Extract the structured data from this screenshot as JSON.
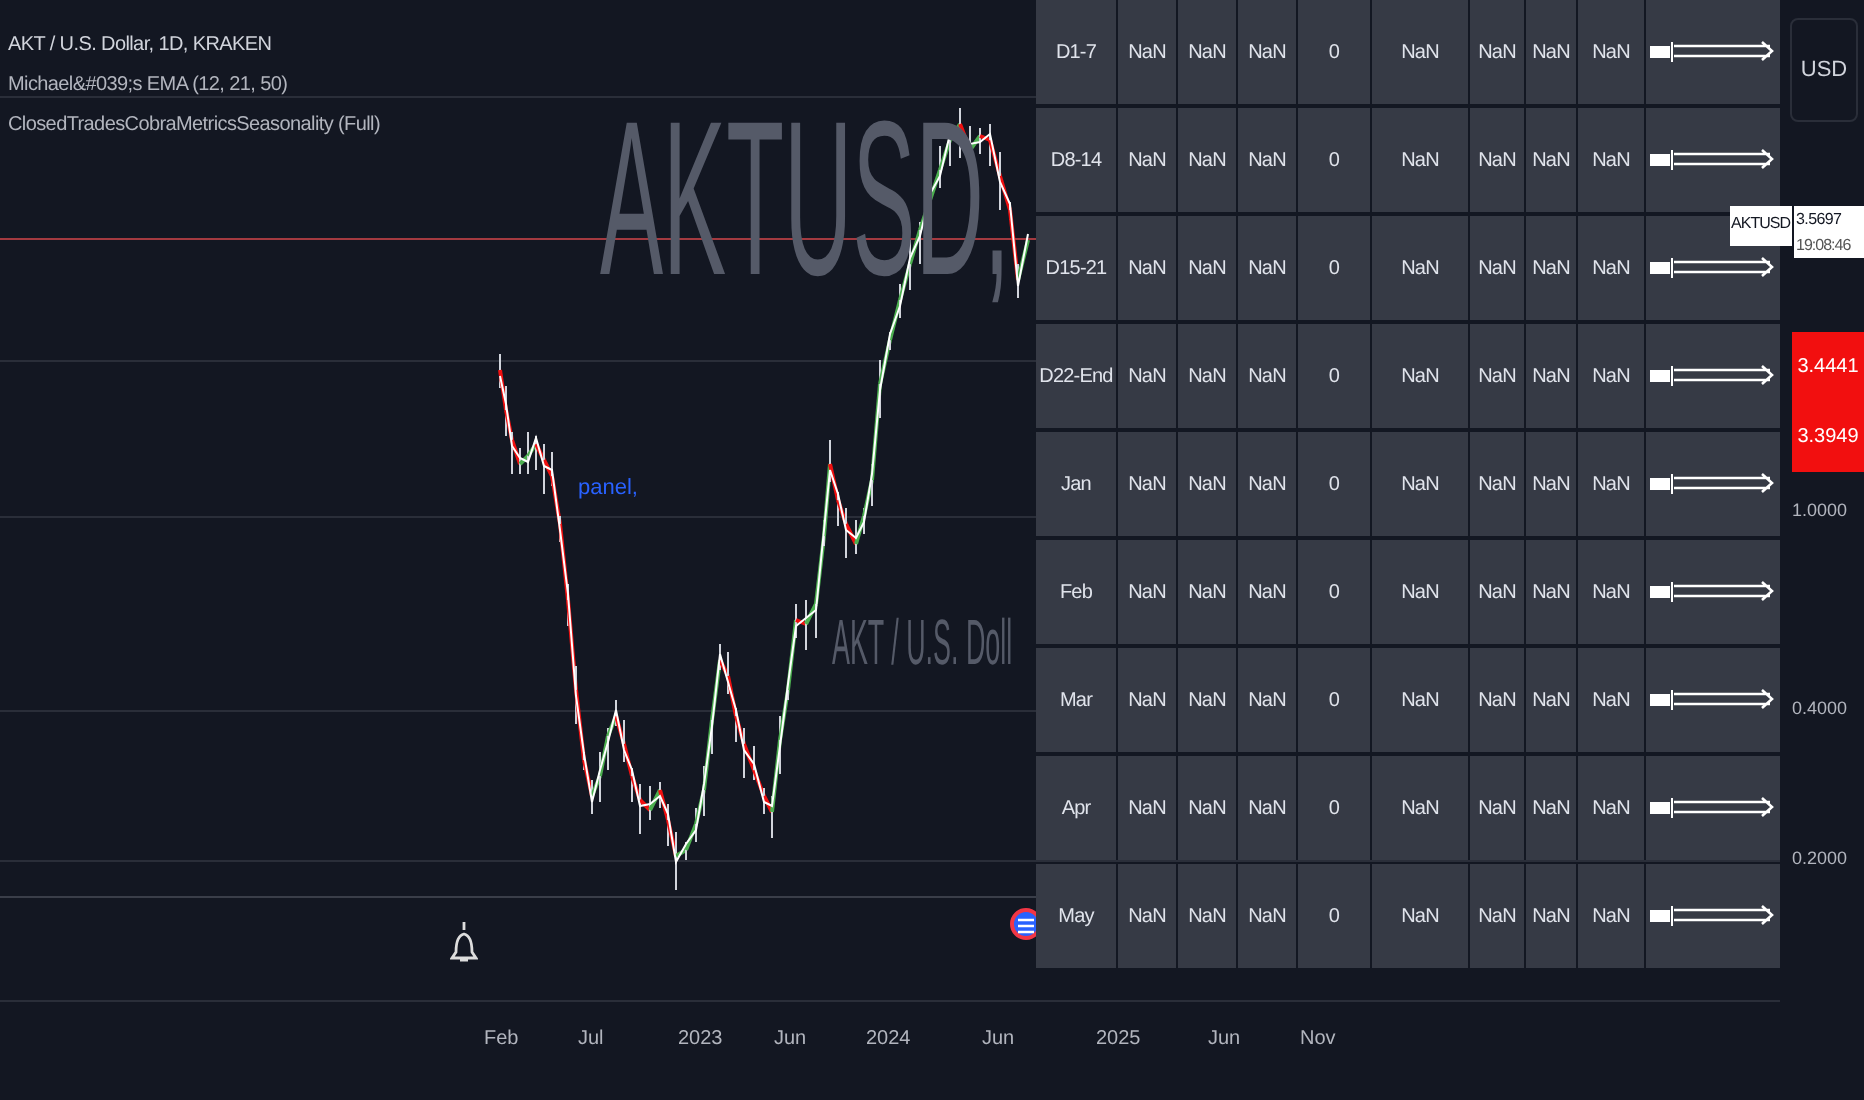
{
  "legend": [
    "AKT / U.S. Dollar, 1D, KRAKEN",
    "Michael&#039;s EMA (12, 21, 50)",
    "ClosedTradesCobraMetricsSeasonality (Full)"
  ],
  "watermark": {
    "symbol": "AKTUSD,",
    "description": "AKT / U.S. Doll"
  },
  "chart_label": "panel,",
  "table": {
    "rows": [
      {
        "label": "D1-7",
        "cells": [
          "NaN",
          "NaN",
          "NaN",
          "0",
          "NaN",
          "NaN",
          "NaN",
          "NaN"
        ]
      },
      {
        "label": "D8-14",
        "cells": [
          "NaN",
          "NaN",
          "NaN",
          "0",
          "NaN",
          "NaN",
          "NaN",
          "NaN"
        ]
      },
      {
        "label": "D15-21",
        "cells": [
          "NaN",
          "NaN",
          "NaN",
          "0",
          "NaN",
          "NaN",
          "NaN",
          "NaN"
        ]
      },
      {
        "label": "D22-End",
        "cells": [
          "NaN",
          "NaN",
          "NaN",
          "0",
          "NaN",
          "NaN",
          "NaN",
          "NaN"
        ]
      },
      {
        "label": "Jan",
        "cells": [
          "NaN",
          "NaN",
          "NaN",
          "0",
          "NaN",
          "NaN",
          "NaN",
          "NaN"
        ]
      },
      {
        "label": "Feb",
        "cells": [
          "NaN",
          "NaN",
          "NaN",
          "0",
          "NaN",
          "NaN",
          "NaN",
          "NaN"
        ]
      },
      {
        "label": "Mar",
        "cells": [
          "NaN",
          "NaN",
          "NaN",
          "0",
          "NaN",
          "NaN",
          "NaN",
          "NaN"
        ]
      },
      {
        "label": "Apr",
        "cells": [
          "NaN",
          "NaN",
          "NaN",
          "0",
          "NaN",
          "NaN",
          "NaN",
          "NaN"
        ]
      },
      {
        "label": "May",
        "cells": [
          "NaN",
          "NaN",
          "NaN",
          "0",
          "NaN",
          "NaN",
          "NaN",
          "NaN"
        ]
      }
    ]
  },
  "price_axis": {
    "currency": "USD",
    "symbol_tag": "AKTUSD",
    "last_price": "3.5697",
    "countdown": "19:08:46",
    "red_labels": [
      "3.4441",
      "3.3949"
    ],
    "ticks": [
      "1.0000",
      "0.4000",
      "0.2000"
    ]
  },
  "time_axis": [
    "Feb",
    "Jul",
    "2023",
    "Jun",
    "2024",
    "Jun",
    "2025",
    "Jun",
    "Nov"
  ]
}
